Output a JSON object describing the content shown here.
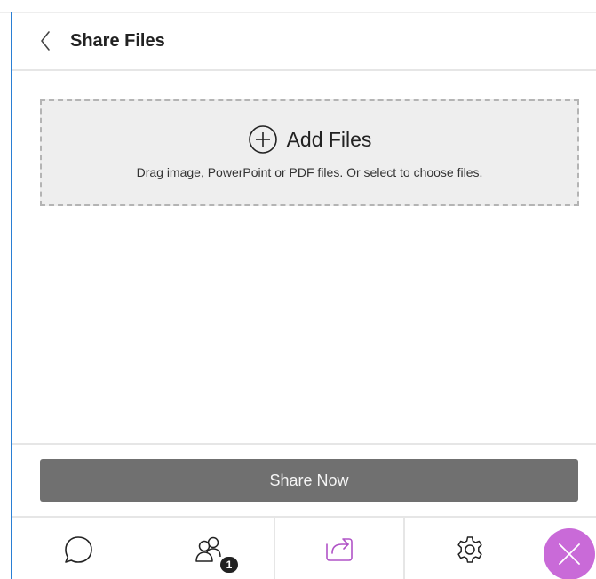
{
  "header": {
    "title": "Share Files",
    "back_icon": "chevron-left-icon"
  },
  "dropzone": {
    "icon": "plus-circle-icon",
    "label": "Add Files",
    "hint": "Drag image, PowerPoint or PDF files. Or select to choose files."
  },
  "actions": {
    "share_now_label": "Share Now"
  },
  "tabbar": {
    "tabs": [
      {
        "name": "chat",
        "icon": "chat-bubble-icon",
        "active": false
      },
      {
        "name": "attendees",
        "icon": "attendees-icon",
        "active": false,
        "badge": "1"
      },
      {
        "name": "share-content",
        "icon": "share-icon",
        "active": true
      },
      {
        "name": "settings",
        "icon": "gear-icon",
        "active": false
      }
    ],
    "close_icon": "close-icon"
  },
  "colors": {
    "accent": "#b053c7",
    "close_bg": "#c96ad8",
    "button_bg": "#707070",
    "dropzone_bg": "#eeeeee",
    "edge": "#2a7fd4"
  }
}
